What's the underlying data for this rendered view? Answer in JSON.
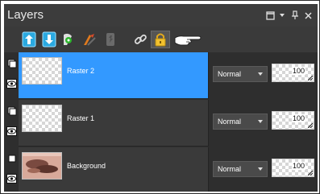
{
  "palette": {
    "title": "Layers"
  },
  "title_buttons": [
    {
      "name": "maximize-icon"
    },
    {
      "name": "chevron-down-icon"
    },
    {
      "name": "pin-icon"
    },
    {
      "name": "close-icon"
    }
  ],
  "toolbar": {
    "icons": [
      "new-raster-layer-icon",
      "new-vector-layer-icon",
      "new-mask-layer-icon",
      "new-adjustment-layer-icon",
      "group-icon",
      "link-icon",
      "lock-icon",
      "pointing-hand-icon"
    ]
  },
  "layers": [
    {
      "name": "Raster 2",
      "blend_mode": "Normal",
      "opacity": "100",
      "selected": true
    },
    {
      "name": "Raster 1",
      "blend_mode": "Normal",
      "opacity": "100",
      "selected": false
    },
    {
      "name": "Background",
      "blend_mode": "Normal",
      "opacity": "100",
      "selected": false
    }
  ],
  "colors": {
    "selected": "#3399ff",
    "panel": "#2e2e2e",
    "row": "#3a3a3a"
  }
}
